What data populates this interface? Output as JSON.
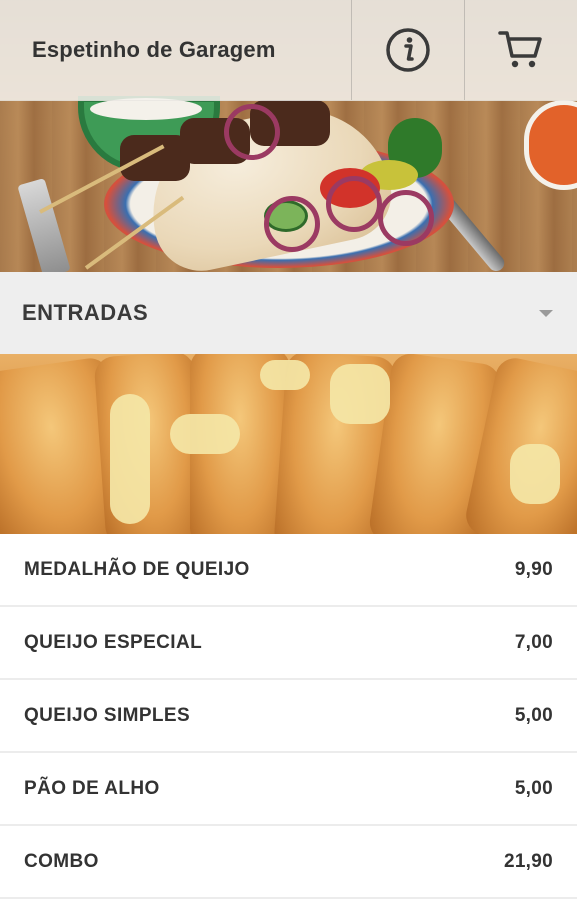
{
  "app": {
    "title": "Espetinho de Garagem",
    "accent_color": "#333333",
    "header_bg": "#f4f2ee"
  },
  "toolbar": {
    "info_icon": "info-circle-icon",
    "cart_icon": "shopping-cart-icon"
  },
  "section": {
    "title": "ENTRADAS",
    "toggle_icon": "dropdown-arrow-icon"
  },
  "images": {
    "hero": "kebab-plate-image",
    "category": "garlic-bread-image"
  },
  "menu": {
    "items": [
      {
        "name": "MEDALHÃO DE QUEIJO",
        "price": "9,90"
      },
      {
        "name": "QUEIJO ESPECIAL",
        "price": "7,00"
      },
      {
        "name": "QUEIJO SIMPLES",
        "price": "5,00"
      },
      {
        "name": "PÃO DE ALHO",
        "price": "5,00"
      },
      {
        "name": "COMBO",
        "price": "21,90"
      }
    ]
  }
}
